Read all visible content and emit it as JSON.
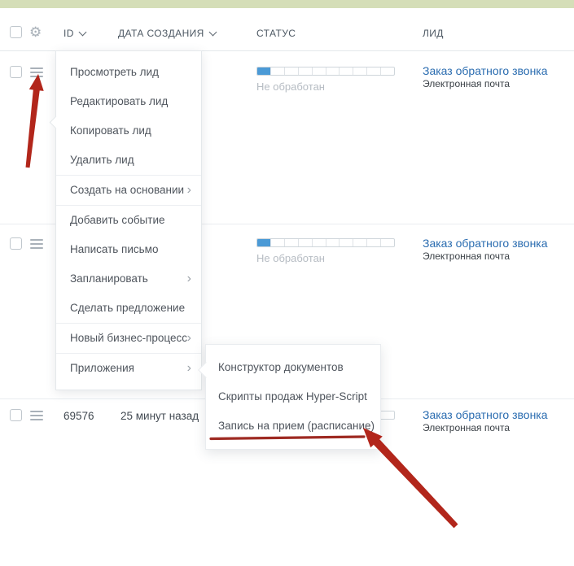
{
  "header": {
    "columns": [
      {
        "label": "ID",
        "sortable": true
      },
      {
        "label": "ДАТА СОЗДАНИЯ",
        "sortable": true
      },
      {
        "label": "СТАТУС",
        "sortable": false
      },
      {
        "label": "ЛИД",
        "sortable": false
      }
    ]
  },
  "context_menu": {
    "items": [
      {
        "label": "Просмотреть лид",
        "has_submenu": false
      },
      {
        "label": "Редактировать лид",
        "has_submenu": false
      },
      {
        "label": "Копировать лид",
        "has_submenu": false
      },
      {
        "label": "Удалить лид",
        "has_submenu": false
      },
      {
        "label": "Создать на основании",
        "has_submenu": true
      },
      {
        "label": "Добавить событие",
        "has_submenu": false
      },
      {
        "label": "Написать письмо",
        "has_submenu": false
      },
      {
        "label": "Запланировать",
        "has_submenu": true
      },
      {
        "label": "Сделать предложение",
        "has_submenu": false
      },
      {
        "label": "Новый бизнес-процесс",
        "has_submenu": true
      },
      {
        "label": "Приложения",
        "has_submenu": true
      }
    ]
  },
  "app_submenu": {
    "items": [
      {
        "label": "Конструктор документов",
        "annotated": false
      },
      {
        "label": "Скрипты продаж Hyper-Script",
        "annotated": false
      },
      {
        "label": "Запись на прием (расписание)",
        "annotated": true
      }
    ]
  },
  "rows": [
    {
      "status_label": "Не обработан",
      "lead_title": "Заказ обратного звонка",
      "lead_source": "Электронная почта"
    },
    {
      "status_label": "Не обработан",
      "lead_title": "Заказ обратного звонка",
      "lead_source": "Электронная почта"
    },
    {
      "id": "69576",
      "created": "25 минут назад",
      "lead_title": "Заказ обратного звонка",
      "lead_source": "Электронная почта"
    }
  ],
  "status_bar": {
    "segments": 10,
    "filled": 1
  },
  "icons": {
    "gear": "⚙",
    "submenu_arrow": "›"
  },
  "colors": {
    "top_bar_green": "#d5deb8",
    "link_blue": "#2a6cb0",
    "status_fill_blue": "#4b9ad6",
    "annotation_red": "#b2261b",
    "underline_red": "#9e2a22",
    "bottom_bar_pink": "#ca6570"
  }
}
